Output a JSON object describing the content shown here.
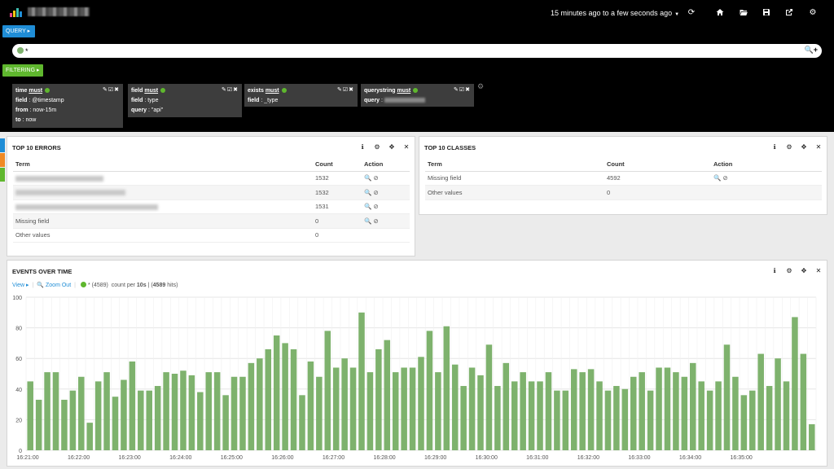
{
  "topnav": {
    "time_range": "15 minutes ago to a few seconds ago",
    "icons": [
      "refresh-icon",
      "home-icon",
      "folder-open-icon",
      "save-icon",
      "share-icon",
      "gear-icon"
    ]
  },
  "query": {
    "button_label": "QUERY ▸",
    "value": "*"
  },
  "filtering": {
    "button_label": "FILTERING ▸",
    "filters": [
      {
        "type": "time",
        "mode": "must",
        "lines": [
          [
            "field",
            "@timestamp"
          ],
          [
            "from",
            "now-15m"
          ],
          [
            "to",
            "now"
          ]
        ]
      },
      {
        "type": "field",
        "mode": "must",
        "lines": [
          [
            "field",
            "type"
          ],
          [
            "query",
            "\"api\""
          ]
        ]
      },
      {
        "type": "exists",
        "mode": "must",
        "lines": [
          [
            "field",
            "_type"
          ]
        ]
      },
      {
        "type": "querystring",
        "mode": "must",
        "lines": [
          [
            "query",
            ""
          ]
        ]
      }
    ]
  },
  "errors_panel": {
    "title": "TOP 10 ERRORS",
    "columns": [
      "Term",
      "Count",
      "Action"
    ],
    "rows": [
      {
        "term": "",
        "count": "1532"
      },
      {
        "term": "",
        "count": "1532"
      },
      {
        "term": "",
        "count": "1531"
      },
      {
        "term": "Missing field",
        "count": "0"
      },
      {
        "term": "Other values",
        "count": "0"
      }
    ]
  },
  "classes_panel": {
    "title": "TOP 10 CLASSES",
    "columns": [
      "Term",
      "Count",
      "Action"
    ],
    "rows": [
      {
        "term": "Missing field",
        "count": "4592"
      },
      {
        "term": "Other values",
        "count": "0"
      }
    ]
  },
  "events_panel": {
    "title": "EVENTS OVER TIME",
    "view_label": "View ▸",
    "zoom_label": "Zoom Out",
    "legend_text": "* (4589)",
    "count_text": "count per",
    "interval": "10s",
    "hits_prefix": "(",
    "hits": "4589",
    "hits_suffix": "hits)"
  },
  "colors": {
    "accent": "#1f8dd6",
    "filter": "#5fb72e",
    "bar": "#7eb26d"
  },
  "chart_data": {
    "type": "bar",
    "ylim": [
      0,
      100
    ],
    "yticks": [
      0,
      20,
      40,
      60,
      80,
      100
    ],
    "xticks": [
      "16:21:00",
      "16:22:00",
      "16:23:00",
      "16:24:00",
      "16:25:00",
      "16:26:00",
      "16:27:00",
      "16:28:00",
      "16:29:00",
      "16:30:00",
      "16:31:00",
      "16:32:00",
      "16:33:00",
      "16:34:00",
      "16:35:00"
    ],
    "grid": true,
    "series": [
      {
        "values": [
          45,
          33,
          51,
          51,
          33,
          39,
          48,
          18,
          45,
          51,
          35,
          46,
          58,
          39,
          39,
          42,
          51,
          50,
          52,
          49,
          38,
          51,
          51,
          36,
          48,
          48,
          57,
          60,
          66,
          75,
          70,
          66,
          36,
          58,
          48,
          78,
          54,
          60,
          54,
          90,
          51,
          66,
          72,
          51,
          54,
          54,
          61,
          78,
          51,
          81,
          56,
          42,
          54,
          49,
          69,
          42,
          57,
          45,
          51,
          45,
          45,
          51,
          39,
          39,
          53,
          51,
          53,
          45,
          39,
          42,
          40,
          48,
          51,
          39,
          54,
          54,
          51,
          48,
          57,
          45,
          39,
          45,
          69,
          48,
          36,
          39,
          63,
          42,
          60,
          45,
          87,
          63,
          17
        ]
      }
    ]
  }
}
